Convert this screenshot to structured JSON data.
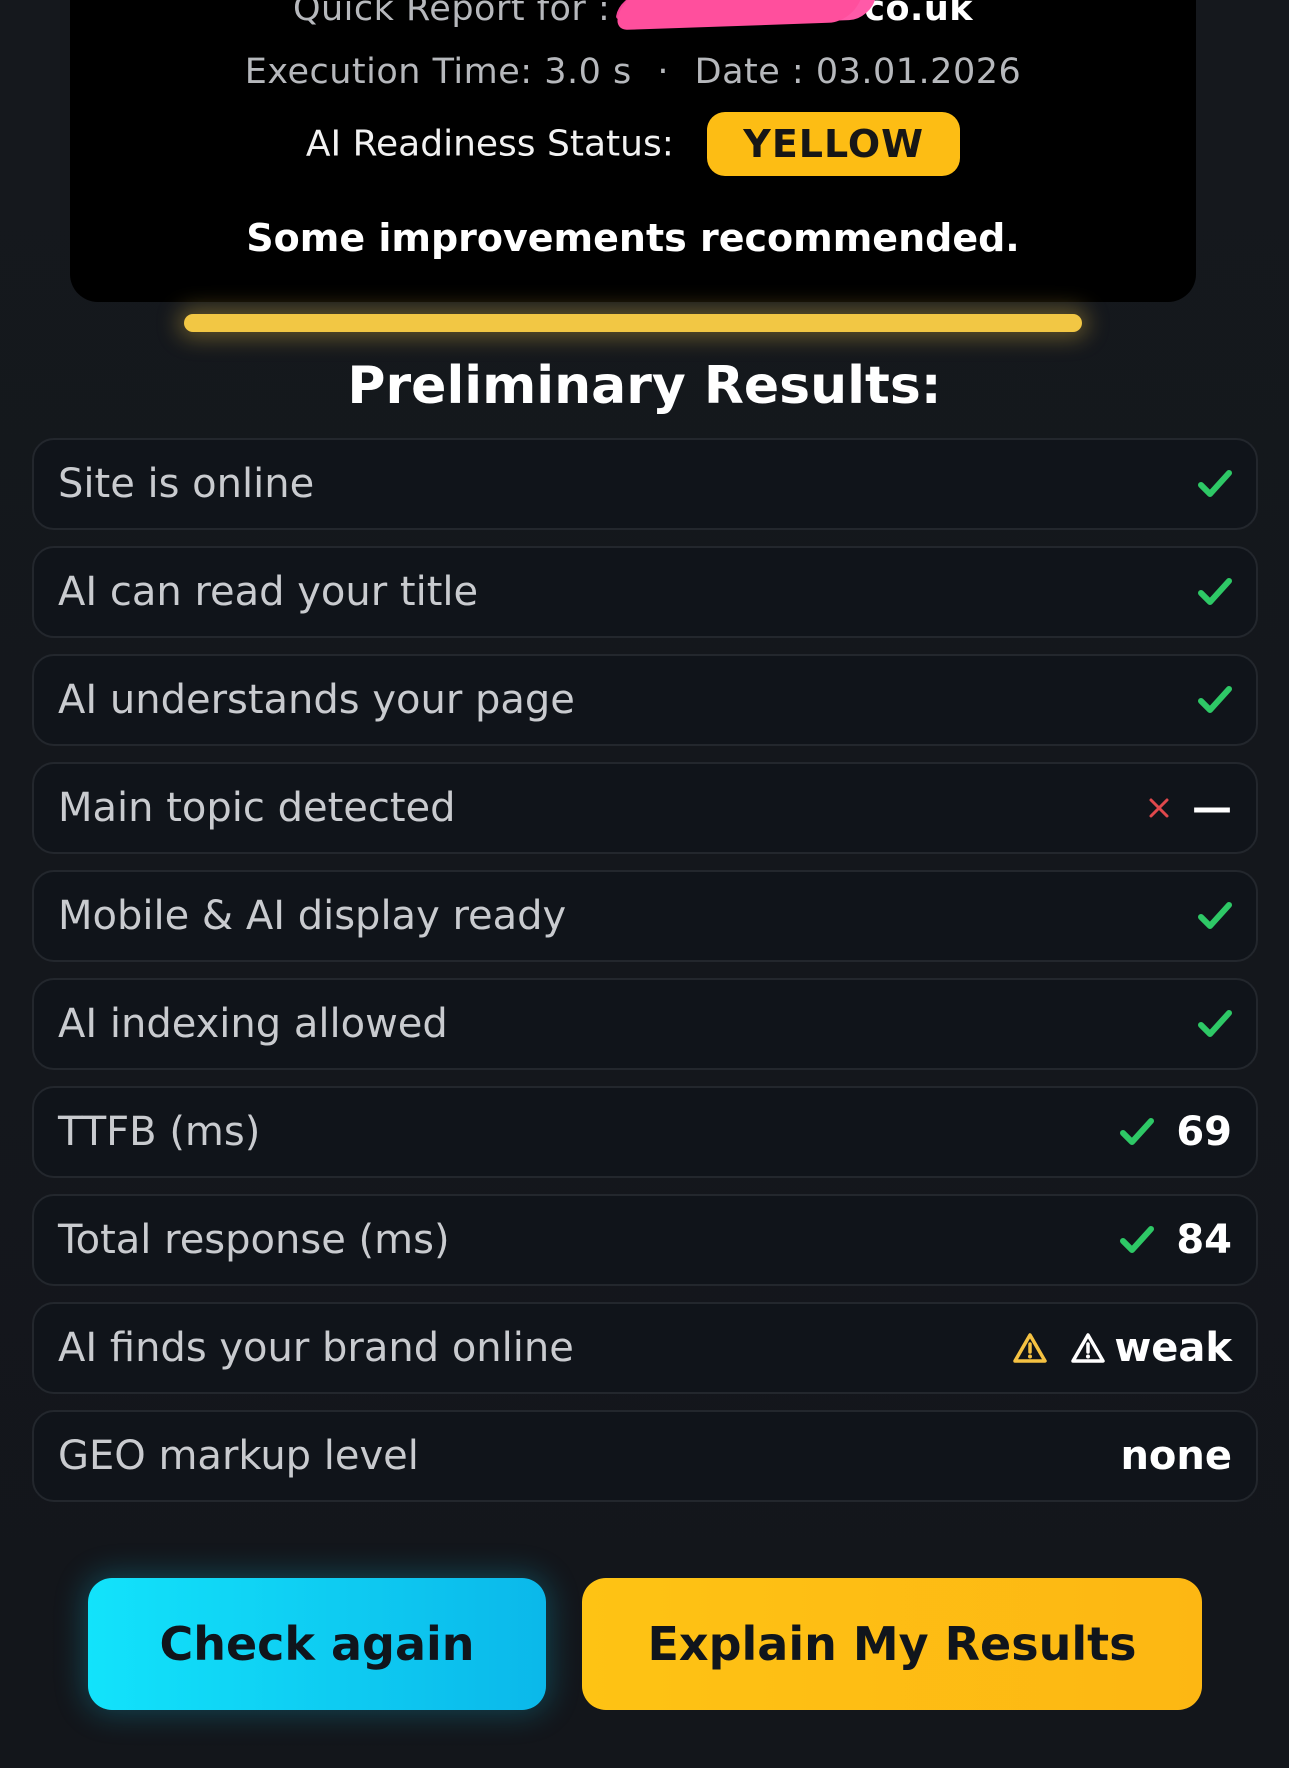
{
  "header": {
    "report_label": "Quick Report for :",
    "domain_visible_suffix": "co.uk",
    "execution_label": "Execution Time:",
    "execution_value": "3.0 s",
    "separator": "·",
    "date_label": "Date :",
    "date_value": "03.01.2026",
    "status_label": "AI Readiness Status:",
    "status_value": "YELLOW",
    "status_message": "Some improvements recommended."
  },
  "section_title": "Preliminary Results:",
  "results": [
    {
      "label": "Site is online",
      "status": "check"
    },
    {
      "label": "AI can read your title",
      "status": "check"
    },
    {
      "label": "AI understands your page",
      "status": "check"
    },
    {
      "label": "Main topic detected",
      "status": "x",
      "value": "—"
    },
    {
      "label": "Mobile & AI display ready",
      "status": "check"
    },
    {
      "label": "AI indexing allowed",
      "status": "check"
    },
    {
      "label": "TTFB (ms)",
      "status": "check",
      "value": "69"
    },
    {
      "label": "Total response (ms)",
      "status": "check",
      "value": "84"
    },
    {
      "label": "AI finds your brand online",
      "status": "warning",
      "value": "weak"
    },
    {
      "label": "GEO markup level",
      "status": "none",
      "value": "none"
    }
  ],
  "buttons": {
    "check_again": "Check again",
    "explain": "Explain My Results"
  },
  "colors": {
    "status_yellow": "#fdbd14",
    "check_green": "#2ec866",
    "x_red": "#e0484c",
    "warn_yellow": "#f5c242",
    "button_cyan": "#12e3fb",
    "button_amber": "#fec314"
  },
  "icons": {
    "check": "check-icon",
    "x": "x-icon",
    "warning": "warning-icon",
    "warning_outline": "warning-outline-icon"
  }
}
